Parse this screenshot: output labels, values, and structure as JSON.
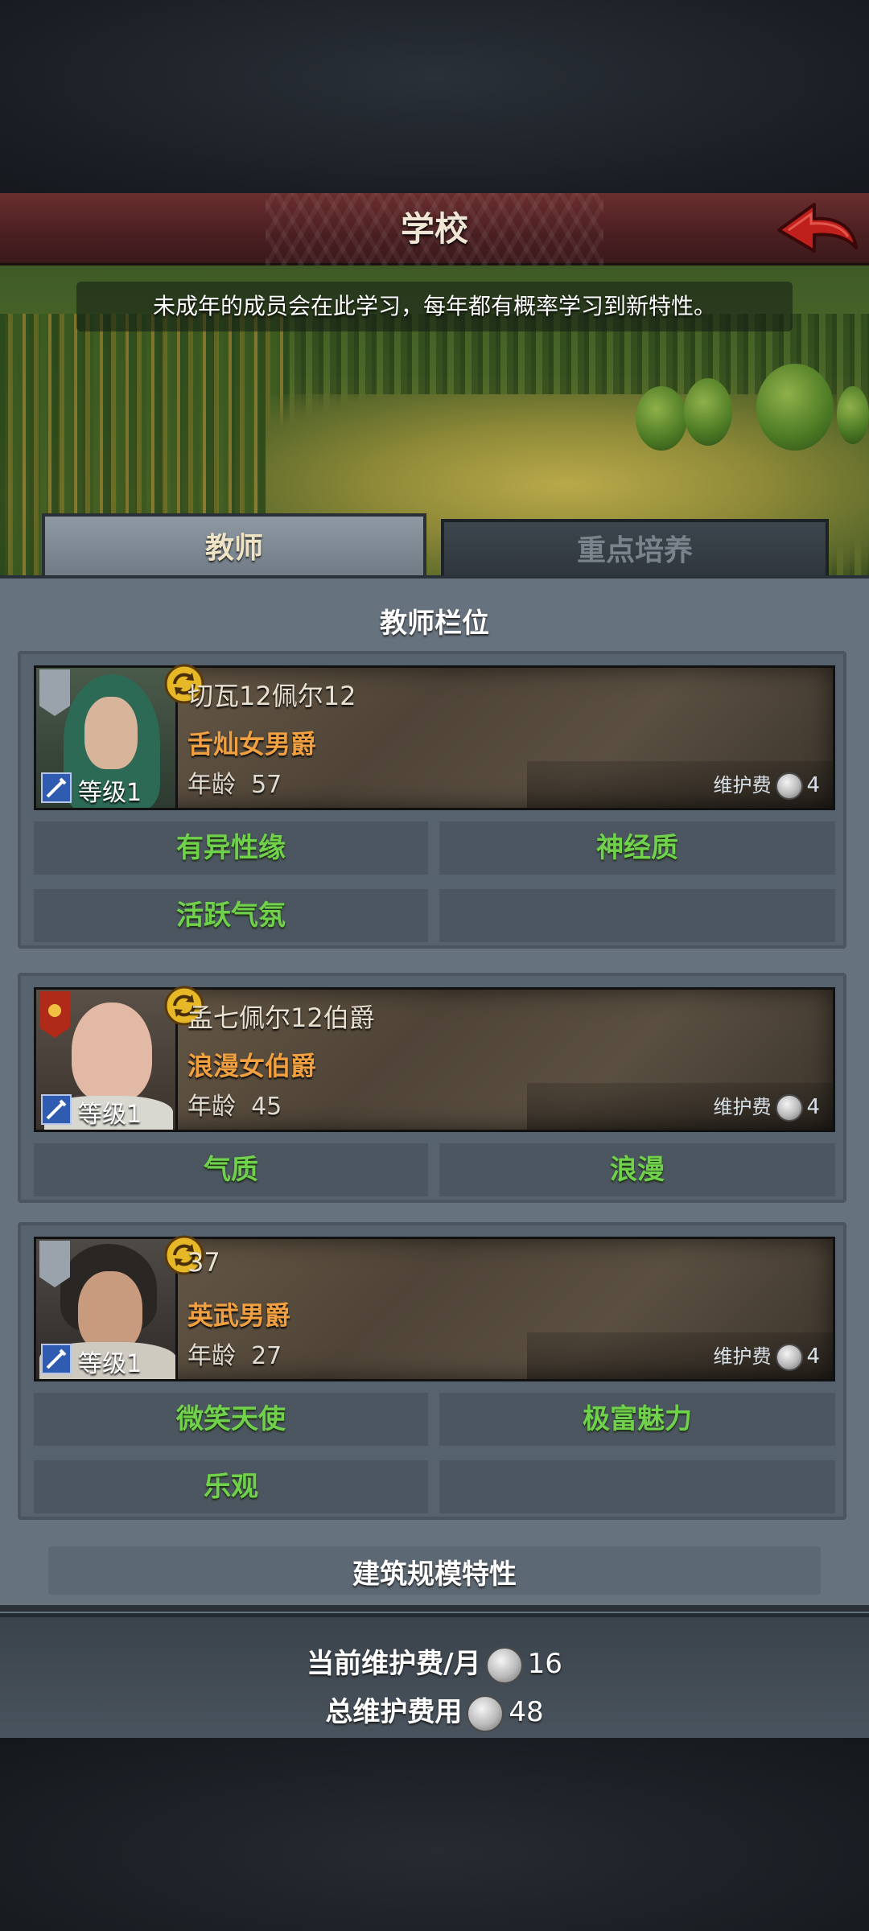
{
  "header": {
    "title": "学校"
  },
  "banner": {
    "description": "未成年的成员会在此学习，每年都有概率学习到新特性。"
  },
  "tabs": [
    {
      "label": "教师",
      "active": true
    },
    {
      "label": "重点培养",
      "active": false
    }
  ],
  "section": {
    "teacher_slots": "教师栏位",
    "building_traits": "建筑规模特性"
  },
  "teachers": [
    {
      "name": "切瓦12佩尔12",
      "title": "舌灿女男爵",
      "age_label": "年龄",
      "age": "57",
      "level": "等级1",
      "upkeep_label": "维护费",
      "upkeep": "4",
      "traits": [
        "有异性缘",
        "神经质",
        "活跃气氛",
        ""
      ]
    },
    {
      "name": "孟七佩尔12伯爵",
      "title": "浪漫女伯爵",
      "age_label": "年龄",
      "age": "45",
      "level": "等级1",
      "upkeep_label": "维护费",
      "upkeep": "4",
      "traits": [
        "气质",
        "浪漫"
      ]
    },
    {
      "name": "37",
      "title": "英武男爵",
      "age_label": "年龄",
      "age": "27",
      "level": "等级1",
      "upkeep_label": "维护费",
      "upkeep": "4",
      "traits": [
        "微笑天使",
        "极富魅力",
        "乐观",
        ""
      ]
    }
  ],
  "footer": {
    "monthly_label": "当前维护费/月",
    "monthly_value": "16",
    "total_label": "总维护费用",
    "total_value": "48"
  },
  "colors": {
    "trait_green": "#6fd24a",
    "title_orange": "#f0a040",
    "header_red": "#6a2e2e"
  },
  "icons": [
    "back-arrow-icon",
    "cycle-icon",
    "sword-icon",
    "shield-icon",
    "silver-coin-icon"
  ]
}
